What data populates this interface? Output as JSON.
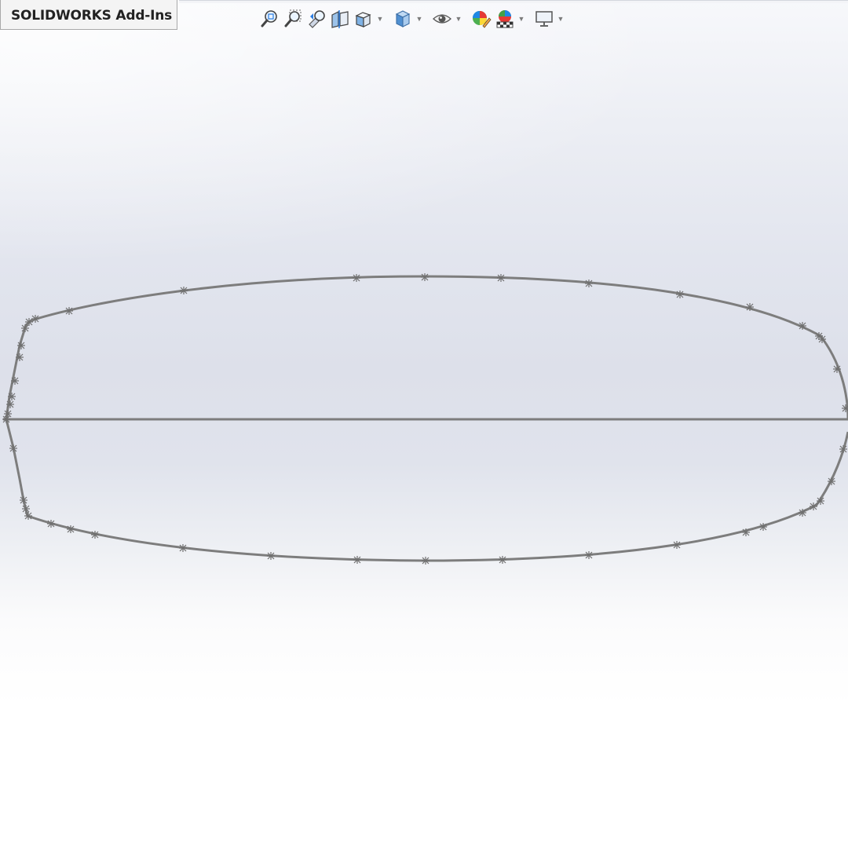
{
  "command_manager": {
    "active_tab_label": "SOLIDWORKS Add-Ins"
  },
  "heads_up_toolbar": {
    "tools": [
      {
        "icon": "zoom-to-fit-icon",
        "has_dropdown": false
      },
      {
        "icon": "zoom-to-area-icon",
        "has_dropdown": false
      },
      {
        "icon": "previous-view-icon",
        "has_dropdown": false
      },
      {
        "icon": "section-view-icon",
        "has_dropdown": false
      },
      {
        "icon": "view-orientation-icon",
        "has_dropdown": true
      },
      {
        "icon": "display-style-icon",
        "has_dropdown": true
      },
      {
        "icon": "hide-show-items-icon",
        "has_dropdown": true
      },
      {
        "icon": "edit-appearance-icon",
        "has_dropdown": false
      },
      {
        "icon": "apply-scene-icon",
        "has_dropdown": true
      },
      {
        "icon": "view-settings-icon",
        "has_dropdown": true
      }
    ]
  },
  "colors": {
    "sketch_line": "#7d7d7d",
    "viewport_top": "#f7f8fb",
    "viewport_mid": "#dde0ea",
    "viewport_bottom": "#ffffff"
  }
}
